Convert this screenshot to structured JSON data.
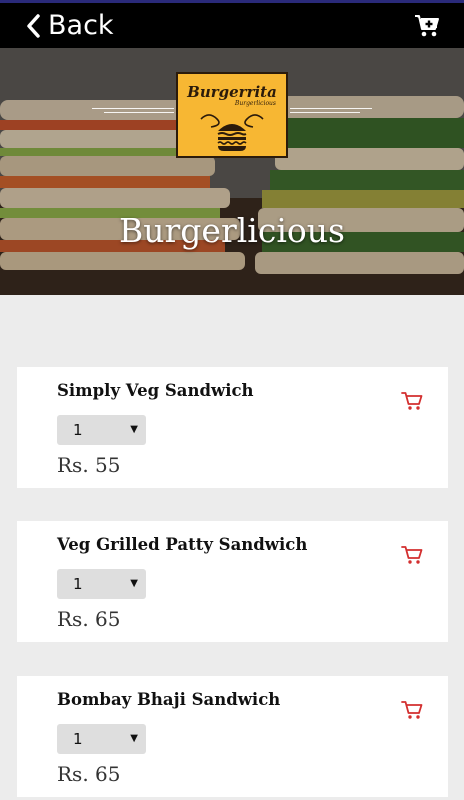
{
  "topbar": {
    "back_label": "Back"
  },
  "hero": {
    "logo_name": "Burgerrita",
    "logo_sub": "Burgerlicious",
    "title": "Burgerlicious"
  },
  "menu": {
    "items": [
      {
        "name": "Simply Veg Sandwich",
        "qty": "1",
        "price": "Rs. 55"
      },
      {
        "name": "Veg Grilled Patty Sandwich",
        "qty": "1",
        "price": "Rs. 65"
      },
      {
        "name": "Bombay Bhaji Sandwich",
        "qty": "1",
        "price": "Rs. 65"
      }
    ]
  },
  "colors": {
    "accent_red": "#d32f2f",
    "topbar": "#000000",
    "logo_bg": "#f7b733"
  }
}
